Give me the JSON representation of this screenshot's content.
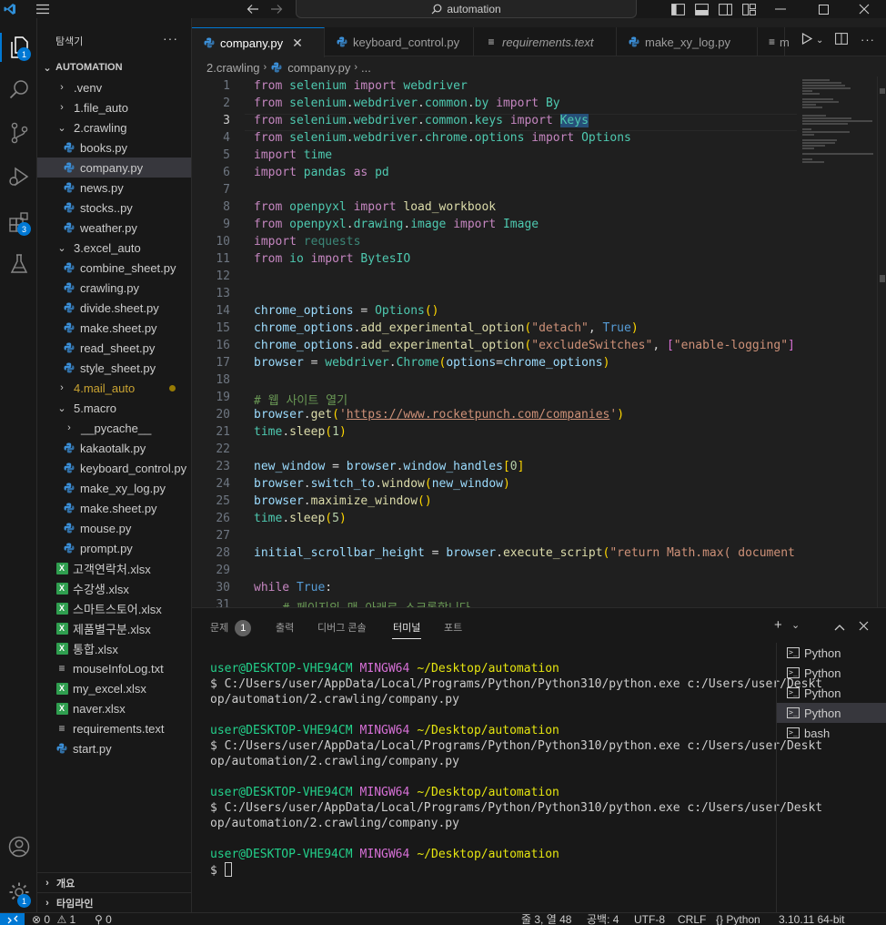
{
  "titlebar": {
    "search": "automation",
    "icons": [
      "vscode-logo-icon",
      "menu-icon",
      "back-arrow-icon",
      "forward-arrow-icon",
      "toggle-primary-sidebar-icon",
      "toggle-panel-icon",
      "toggle-secondary-sidebar-icon",
      "customize-layout-icon",
      "minimize-icon",
      "maximize-icon",
      "close-icon"
    ]
  },
  "activitybar": {
    "explorer_badge": "1",
    "extensions_badge": "3",
    "settings_badge": "1"
  },
  "sidebar": {
    "title": "탐색기",
    "root": "AUTOMATION",
    "items": [
      {
        "label": ".venv",
        "kind": "folder",
        "open": false,
        "indent": 1
      },
      {
        "label": "1.file_auto",
        "kind": "folder",
        "open": false,
        "indent": 1
      },
      {
        "label": "2.crawling",
        "kind": "folder",
        "open": true,
        "indent": 1
      },
      {
        "label": "books.py",
        "kind": "py",
        "indent": 2
      },
      {
        "label": "company.py",
        "kind": "py",
        "indent": 2,
        "selected": true
      },
      {
        "label": "news.py",
        "kind": "py",
        "indent": 2
      },
      {
        "label": "stocks..py",
        "kind": "py",
        "indent": 2
      },
      {
        "label": "weather.py",
        "kind": "py",
        "indent": 2
      },
      {
        "label": "3.excel_auto",
        "kind": "folder",
        "open": true,
        "indent": 1
      },
      {
        "label": "combine_sheet.py",
        "kind": "py",
        "indent": 2
      },
      {
        "label": "crawling.py",
        "kind": "py",
        "indent": 2
      },
      {
        "label": "divide.sheet.py",
        "kind": "py",
        "indent": 2
      },
      {
        "label": "make.sheet.py",
        "kind": "py",
        "indent": 2
      },
      {
        "label": "read_sheet.py",
        "kind": "py",
        "indent": 2
      },
      {
        "label": "style_sheet.py",
        "kind": "py",
        "indent": 2
      },
      {
        "label": "4.mail_auto",
        "kind": "folder",
        "open": false,
        "indent": 1,
        "modified": true
      },
      {
        "label": "5.macro",
        "kind": "folder",
        "open": true,
        "indent": 1
      },
      {
        "label": "__pycache__",
        "kind": "folder",
        "open": false,
        "indent": 2
      },
      {
        "label": "kakaotalk.py",
        "kind": "py",
        "indent": 2
      },
      {
        "label": "keyboard_control.py",
        "kind": "py",
        "indent": 2
      },
      {
        "label": "make_xy_log.py",
        "kind": "py",
        "indent": 2
      },
      {
        "label": "make.sheet.py",
        "kind": "py",
        "indent": 2
      },
      {
        "label": "mouse.py",
        "kind": "py",
        "indent": 2
      },
      {
        "label": "prompt.py",
        "kind": "py",
        "indent": 2
      },
      {
        "label": "고객연락처.xlsx",
        "kind": "xlsx",
        "indent": 1
      },
      {
        "label": "수강생.xlsx",
        "kind": "xlsx",
        "indent": 1
      },
      {
        "label": "스마트스토어.xlsx",
        "kind": "xlsx",
        "indent": 1
      },
      {
        "label": "제품별구분.xlsx",
        "kind": "xlsx",
        "indent": 1
      },
      {
        "label": "통합.xlsx",
        "kind": "xlsx",
        "indent": 1
      },
      {
        "label": "mouseInfoLog.txt",
        "kind": "txt",
        "indent": 1
      },
      {
        "label": "my_excel.xlsx",
        "kind": "xlsx",
        "indent": 1
      },
      {
        "label": "naver.xlsx",
        "kind": "xlsx",
        "indent": 1
      },
      {
        "label": "requirements.text",
        "kind": "txt",
        "indent": 1
      },
      {
        "label": "start.py",
        "kind": "py",
        "indent": 1
      }
    ],
    "outline": "개요",
    "timeline": "타임라인"
  },
  "tabs": [
    {
      "label": "company.py",
      "kind": "py",
      "active": true,
      "italic": false
    },
    {
      "label": "keyboard_control.py",
      "kind": "py",
      "active": false,
      "italic": false
    },
    {
      "label": "requirements.text",
      "kind": "txt",
      "active": false,
      "italic": true
    },
    {
      "label": "make_xy_log.py",
      "kind": "py",
      "active": false,
      "italic": false
    },
    {
      "label": "m",
      "kind": "txt",
      "active": false,
      "italic": false
    }
  ],
  "breadcrumb": {
    "folder": "2.crawling",
    "file": "company.py",
    "rest": "..."
  },
  "editor": {
    "current_line": 3,
    "lines": [
      {
        "n": 1,
        "html": "<span class='k'>from</span> <span class='t'>selenium</span> <span class='k'>import</span> <span class='t'>webdriver</span>"
      },
      {
        "n": 2,
        "html": "<span class='k'>from</span> <span class='t'>selenium</span><span class='w'>.</span><span class='t'>webdriver</span><span class='w'>.</span><span class='t'>common</span><span class='w'>.</span><span class='t'>by</span> <span class='k'>import</span> <span class='t'>By</span>"
      },
      {
        "n": 3,
        "html": "<span class='k'>from</span> <span class='t'>selenium</span><span class='w'>.</span><span class='t'>webdriver</span><span class='w'>.</span><span class='t'>common</span><span class='w'>.</span><span class='t'>keys</span> <span class='k'>import</span> <span class='t hl'>Keys</span>"
      },
      {
        "n": 4,
        "html": "<span class='k'>from</span> <span class='t'>selenium</span><span class='w'>.</span><span class='t'>webdriver</span><span class='w'>.</span><span class='t'>chrome</span><span class='w'>.</span><span class='t'>options</span> <span class='k'>import</span> <span class='t'>Options</span>"
      },
      {
        "n": 5,
        "html": "<span class='k'>import</span> <span class='t'>time</span>"
      },
      {
        "n": 6,
        "html": "<span class='k'>import</span> <span class='t'>pandas</span> <span class='k'>as</span> <span class='t'>pd</span>"
      },
      {
        "n": 7,
        "html": ""
      },
      {
        "n": 8,
        "html": "<span class='k'>from</span> <span class='t'>openpyxl</span> <span class='k'>import</span> <span class='f'>load_workbook</span>"
      },
      {
        "n": 9,
        "html": "<span class='k'>from</span> <span class='t'>openpyxl</span><span class='w'>.</span><span class='t'>drawing</span><span class='w'>.</span><span class='t'>image</span> <span class='k'>import</span> <span class='t'>Image</span>"
      },
      {
        "n": 10,
        "html": "<span class='k'>import</span> <span class='dim'>requests</span>"
      },
      {
        "n": 11,
        "html": "<span class='k'>from</span> <span class='t'>io</span> <span class='k'>import</span> <span class='t'>BytesIO</span>"
      },
      {
        "n": 12,
        "html": ""
      },
      {
        "n": 13,
        "html": ""
      },
      {
        "n": 14,
        "html": "<span class='v'>chrome_options</span> <span class='w'>=</span> <span class='t'>Options</span><span class='py'>()</span>"
      },
      {
        "n": 15,
        "html": "<span class='v'>chrome_options</span><span class='w'>.</span><span class='f'>add_experimental_option</span><span class='py'>(</span><span class='s'>\"detach\"</span><span class='w'>, </span><span class='b'>True</span><span class='py'>)</span>"
      },
      {
        "n": 16,
        "html": "<span class='v'>chrome_options</span><span class='w'>.</span><span class='f'>add_experimental_option</span><span class='py'>(</span><span class='s'>\"excludeSwitches\"</span><span class='w'>, </span><span class='pb'>[</span><span class='s'>\"enable-logging\"</span><span class='pb'>]</span><span class='py'>)</span>"
      },
      {
        "n": 17,
        "html": "<span class='v'>browser</span> <span class='w'>=</span> <span class='t'>webdriver</span><span class='w'>.</span><span class='t'>Chrome</span><span class='py'>(</span><span class='v'>options</span><span class='w'>=</span><span class='v'>chrome_options</span><span class='py'>)</span>"
      },
      {
        "n": 18,
        "html": ""
      },
      {
        "n": 19,
        "html": "<span class='c'># 웹 사이트 열기</span>"
      },
      {
        "n": 20,
        "html": "<span class='v'>browser</span><span class='w'>.</span><span class='f'>get</span><span class='py'>(</span><span class='s'>'</span><span class='u'>https://www.rocketpunch.com/companies</span><span class='s'>'</span><span class='py'>)</span>"
      },
      {
        "n": 21,
        "html": "<span class='t'>time</span><span class='w'>.</span><span class='f'>sleep</span><span class='py'>(</span><span class='n'>1</span><span class='py'>)</span>"
      },
      {
        "n": 22,
        "html": ""
      },
      {
        "n": 23,
        "html": "<span class='v'>new_window</span> <span class='w'>=</span> <span class='v'>browser</span><span class='w'>.</span><span class='v'>window_handles</span><span class='py'>[</span><span class='n'>0</span><span class='py'>]</span>"
      },
      {
        "n": 24,
        "html": "<span class='v'>browser</span><span class='w'>.</span><span class='v'>switch_to</span><span class='w'>.</span><span class='f'>window</span><span class='py'>(</span><span class='v'>new_window</span><span class='py'>)</span>"
      },
      {
        "n": 25,
        "html": "<span class='v'>browser</span><span class='w'>.</span><span class='f'>maximize_window</span><span class='py'>()</span>"
      },
      {
        "n": 26,
        "html": "<span class='t'>time</span><span class='w'>.</span><span class='f'>sleep</span><span class='py'>(</span><span class='n'>5</span><span class='py'>)</span>"
      },
      {
        "n": 27,
        "html": ""
      },
      {
        "n": 28,
        "html": "<span class='v'>initial_scrollbar_height</span> <span class='w'>=</span> <span class='v'>browser</span><span class='w'>.</span><span class='f'>execute_script</span><span class='py'>(</span><span class='s'>\"return Math.max( document.b</span>"
      },
      {
        "n": 29,
        "html": ""
      },
      {
        "n": 30,
        "html": "<span class='k'>while</span> <span class='b'>True</span><span class='w'>:</span>"
      },
      {
        "n": 31,
        "html": "    <span class='c'># 페이지의 맨 아래로 스크롤합니다.</span>"
      }
    ]
  },
  "panel": {
    "tabs": [
      {
        "label": "문제",
        "badge": "1",
        "active": false
      },
      {
        "label": "출력",
        "active": false
      },
      {
        "label": "디버그 콘솔",
        "active": false
      },
      {
        "label": "터미널",
        "active": true
      },
      {
        "label": "포트",
        "active": false
      }
    ],
    "terminal_lines": [
      {
        "type": "prompt",
        "user": "user@DESKTOP-VHE94CM",
        "shell": "MINGW64",
        "path": "~/Desktop/automation"
      },
      {
        "type": "text",
        "text": "$ C:/Users/user/AppData/Local/Programs/Python/Python310/python.exe c:/Users/user/Deskt"
      },
      {
        "type": "text",
        "text": "op/automation/2.crawling/company.py"
      },
      {
        "type": "blank"
      },
      {
        "type": "prompt",
        "user": "user@DESKTOP-VHE94CM",
        "shell": "MINGW64",
        "path": "~/Desktop/automation"
      },
      {
        "type": "text",
        "text": "$ C:/Users/user/AppData/Local/Programs/Python/Python310/python.exe c:/Users/user/Deskt"
      },
      {
        "type": "text",
        "text": "op/automation/2.crawling/company.py"
      },
      {
        "type": "blank"
      },
      {
        "type": "prompt",
        "user": "user@DESKTOP-VHE94CM",
        "shell": "MINGW64",
        "path": "~/Desktop/automation"
      },
      {
        "type": "text",
        "text": "$ C:/Users/user/AppData/Local/Programs/Python/Python310/python.exe c:/Users/user/Deskt"
      },
      {
        "type": "text",
        "text": "op/automation/2.crawling/company.py"
      },
      {
        "type": "blank"
      },
      {
        "type": "prompt",
        "user": "user@DESKTOP-VHE94CM",
        "shell": "MINGW64",
        "path": "~/Desktop/automation"
      },
      {
        "type": "cursor",
        "text": "$ "
      }
    ],
    "terminals": [
      {
        "label": "Python",
        "active": false
      },
      {
        "label": "Python",
        "active": false
      },
      {
        "label": "Python",
        "active": false
      },
      {
        "label": "Python",
        "active": true
      },
      {
        "label": "bash",
        "active": false
      }
    ]
  },
  "statusbar": {
    "errors": "0",
    "warnings": "1",
    "ports": "0",
    "position": "줄 3, 열 48",
    "spaces": "공백: 4",
    "encoding": "UTF-8",
    "eol": "CRLF",
    "language": "Python",
    "interpreter": "3.10.11 64-bit"
  },
  "colors": {
    "accent": "#0078d4",
    "background": "#1f1f1f",
    "sidebar": "#181818"
  }
}
